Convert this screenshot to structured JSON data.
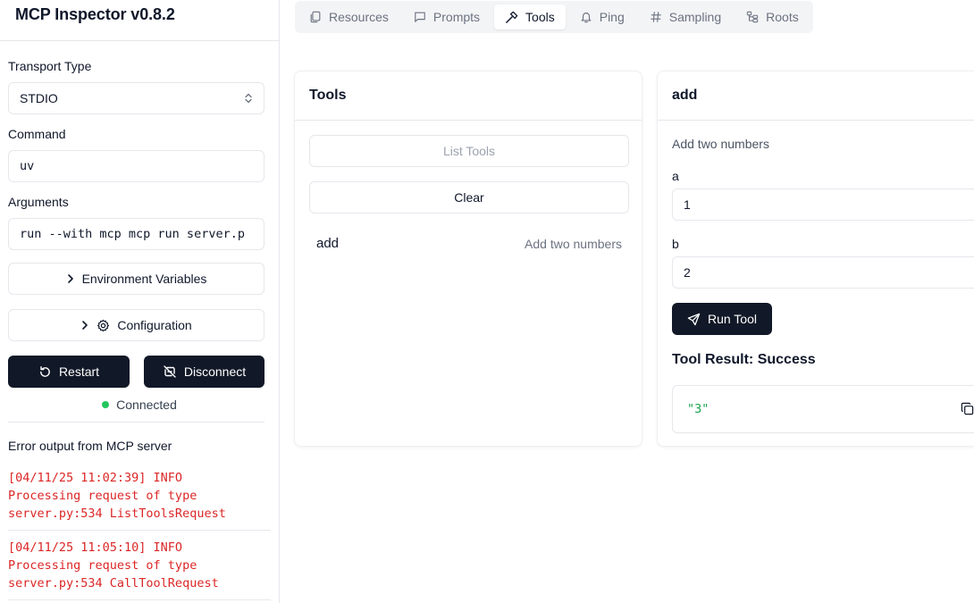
{
  "app": {
    "title": "MCP Inspector v0.8.2"
  },
  "sidebar": {
    "transport_label": "Transport Type",
    "transport_value": "STDIO",
    "command_label": "Command",
    "command_value": "uv",
    "arguments_label": "Arguments",
    "arguments_value": "run --with mcp mcp run server.p",
    "env_button": "Environment Variables",
    "config_button": "Configuration",
    "restart_button": "Restart",
    "disconnect_button": "Disconnect",
    "status": "Connected",
    "status_color": "#22c55e",
    "error_title": "Error output from MCP server",
    "logs": [
      "[04/11/25 11:02:39] INFO\nProcessing request of type\nserver.py:534 ListToolsRequest",
      "[04/11/25 11:05:10] INFO\nProcessing request of type\nserver.py:534 CallToolRequest"
    ]
  },
  "tabs": [
    {
      "label": "Resources",
      "icon": "files-icon"
    },
    {
      "label": "Prompts",
      "icon": "message-icon"
    },
    {
      "label": "Tools",
      "icon": "hammer-icon",
      "active": true
    },
    {
      "label": "Ping",
      "icon": "bell-icon"
    },
    {
      "label": "Sampling",
      "icon": "hash-icon"
    },
    {
      "label": "Roots",
      "icon": "folder-tree-icon"
    }
  ],
  "tools_panel": {
    "title": "Tools",
    "list_button": "List Tools",
    "clear_button": "Clear",
    "items": [
      {
        "name": "add",
        "description": "Add two numbers"
      }
    ]
  },
  "tool_detail": {
    "title": "add",
    "description": "Add two numbers",
    "params": [
      {
        "name": "a",
        "value": "1"
      },
      {
        "name": "b",
        "value": "2"
      }
    ],
    "run_button": "Run Tool",
    "result_title": "Tool Result: Success",
    "result_value": "\"3\""
  },
  "colors": {
    "primary_dark": "#111827",
    "error_text": "#dc2626",
    "success_text": "#16a34a"
  }
}
